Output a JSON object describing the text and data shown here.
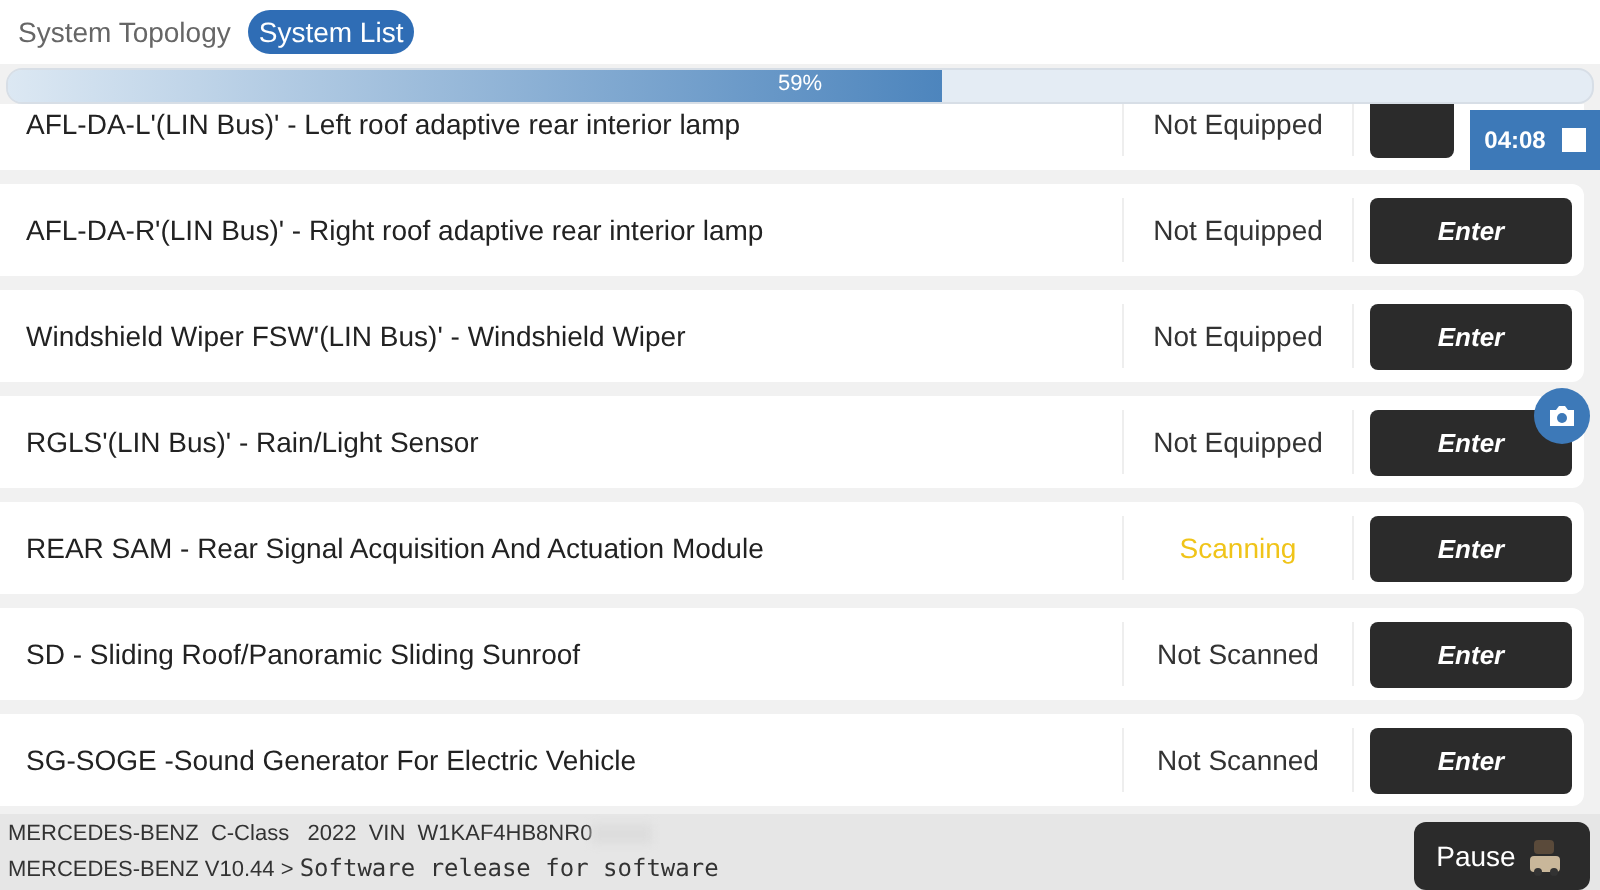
{
  "tabs": [
    {
      "label": "System Topology",
      "selected": false
    },
    {
      "label": "System List",
      "selected": true
    }
  ],
  "progress": {
    "level": 0.59,
    "reading": "59%"
  },
  "systems": [
    {
      "name": "AFL-DA-L'(LIN Bus)' - Left roof adaptive rear interior lamp",
      "status": "Not Equipped",
      "kind": "not_equipped"
    },
    {
      "name": "AFL-DA-R'(LIN Bus)' - Right roof adaptive rear interior lamp",
      "status": "Not Equipped",
      "kind": "not_equipped",
      "button": "Enter"
    },
    {
      "name": "Windshield Wiper FSW'(LIN Bus)' - Windshield Wiper",
      "status": "Not Equipped",
      "kind": "not_equipped",
      "button": "Enter"
    },
    {
      "name": "RGLS'(LIN Bus)' - Rain/Light Sensor",
      "status": "Not Equipped",
      "kind": "not_equipped",
      "button": "Enter"
    },
    {
      "name": "REAR SAM - Rear Signal Acquisition And Actuation Module",
      "status": "Scanning",
      "kind": "scanning",
      "button": "Enter"
    },
    {
      "name": "SD - Sliding Roof/Panoramic Sliding Sunroof",
      "status": "Not Scanned",
      "kind": "not_scanned",
      "button": "Enter"
    },
    {
      "name": "SG-SOGE -Sound Generator For Electric Vehicle",
      "status": "Not Scanned",
      "kind": "not_scanned",
      "button": "Enter"
    }
  ],
  "timer": "04:08",
  "footer": {
    "vehicle": "MERCEDES-BENZ  C-Class   2022  VIN  W1KAF4HB8NR0",
    "version": "MERCEDES-BENZ V10.44 >",
    "message": "Software release for software",
    "pause": "Pause"
  }
}
